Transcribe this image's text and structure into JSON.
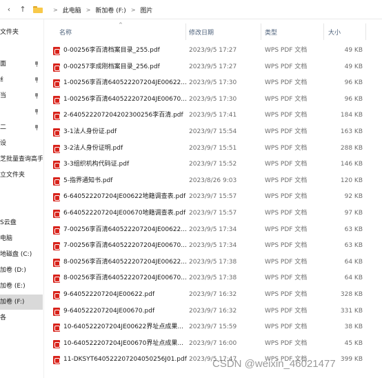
{
  "address_bar": {
    "back_glyph": "‹",
    "up_glyph": "↑",
    "breadcrumbs": [
      "此电脑",
      "新加卷 (F:)",
      "图片"
    ]
  },
  "nav_pane": {
    "items": [
      {
        "label": "文件夹",
        "pinned": false,
        "selected": false
      },
      {
        "label": "",
        "pinned": false,
        "selected": false
      },
      {
        "label": "面",
        "pinned": true,
        "selected": false
      },
      {
        "label": "纟",
        "pinned": true,
        "selected": false
      },
      {
        "label": "当",
        "pinned": true,
        "selected": false
      },
      {
        "label": "",
        "pinned": true,
        "selected": false
      },
      {
        "label": "二",
        "pinned": true,
        "selected": false
      },
      {
        "label": "设",
        "pinned": false,
        "selected": false
      },
      {
        "label": "芝批量查询高手",
        "pinned": false,
        "selected": false
      },
      {
        "label": "立文件夹",
        "pinned": false,
        "selected": false
      },
      {
        "label": "",
        "pinned": false,
        "selected": false
      },
      {
        "label": "",
        "pinned": false,
        "selected": false
      },
      {
        "label": "S云盘",
        "pinned": false,
        "selected": false
      },
      {
        "label": "电脑",
        "pinned": false,
        "selected": false
      },
      {
        "label": "地磁盘 (C:)",
        "pinned": false,
        "selected": false
      },
      {
        "label": "加卷 (D:)",
        "pinned": false,
        "selected": false
      },
      {
        "label": "加卷 (E:)",
        "pinned": false,
        "selected": false
      },
      {
        "label": "加卷 (F:)",
        "pinned": false,
        "selected": true
      },
      {
        "label": "各",
        "pinned": false,
        "selected": false
      }
    ]
  },
  "columns": {
    "name": "名称",
    "date": "修改日期",
    "type": "类型",
    "size": "大小",
    "sort_glyph": "^"
  },
  "files": [
    {
      "name": "0-00256李百清档案目录_255.pdf",
      "date": "2023/9/5 17:27",
      "type": "WPS PDF 文档",
      "size": "49 KB"
    },
    {
      "name": "0-00257李成刚档案目录_256.pdf",
      "date": "2023/9/5 17:27",
      "type": "WPS PDF 文档",
      "size": "49 KB"
    },
    {
      "name": "1-00256李百清640522207204JE00622...",
      "date": "2023/9/5 17:30",
      "type": "WPS PDF 文档",
      "size": "96 KB"
    },
    {
      "name": "1-00256李百清640522207204JE00670...",
      "date": "2023/9/5 17:30",
      "type": "WPS PDF 文档",
      "size": "96 KB"
    },
    {
      "name": "2-640522207204202300256李百清.pdf",
      "date": "2023/9/5 17:41",
      "type": "WPS PDF 文档",
      "size": "184 KB"
    },
    {
      "name": "3-1法人身份证.pdf",
      "date": "2023/9/7 15:54",
      "type": "WPS PDF 文档",
      "size": "163 KB"
    },
    {
      "name": "3-2法人身份证明.pdf",
      "date": "2023/9/7 15:51",
      "type": "WPS PDF 文档",
      "size": "288 KB"
    },
    {
      "name": "3-3组织机构代码证.pdf",
      "date": "2023/9/7 15:52",
      "type": "WPS PDF 文档",
      "size": "146 KB"
    },
    {
      "name": "5-指界通知书.pdf",
      "date": "2023/8/26 9:03",
      "type": "WPS PDF 文档",
      "size": "120 KB"
    },
    {
      "name": "6-640522207204JE00622地籍调查表.pdf",
      "date": "2023/9/7 15:57",
      "type": "WPS PDF 文档",
      "size": "92 KB"
    },
    {
      "name": "6-640522207204JE00670地籍调查表.pdf",
      "date": "2023/9/7 15:57",
      "type": "WPS PDF 文档",
      "size": "97 KB"
    },
    {
      "name": "7-00256李百清640522207204JE00622...",
      "date": "2023/9/5 17:34",
      "type": "WPS PDF 文档",
      "size": "63 KB"
    },
    {
      "name": "7-00256李百清640522207204JE00670...",
      "date": "2023/9/5 17:34",
      "type": "WPS PDF 文档",
      "size": "63 KB"
    },
    {
      "name": "8-00256李百清640522207204JE00622...",
      "date": "2023/9/5 17:38",
      "type": "WPS PDF 文档",
      "size": "64 KB"
    },
    {
      "name": "8-00256李百清640522207204JE00670...",
      "date": "2023/9/5 17:38",
      "type": "WPS PDF 文档",
      "size": "64 KB"
    },
    {
      "name": "9-640522207204JE00622.pdf",
      "date": "2023/9/7 16:32",
      "type": "WPS PDF 文档",
      "size": "328 KB"
    },
    {
      "name": "9-640522207204JE00670.pdf",
      "date": "2023/9/7 16:32",
      "type": "WPS PDF 文档",
      "size": "331 KB"
    },
    {
      "name": "10-640522207204JE00622界址点成果...",
      "date": "2023/9/7 15:59",
      "type": "WPS PDF 文档",
      "size": "38 KB"
    },
    {
      "name": "10-640522207204JE00670界址点成果...",
      "date": "2023/9/7 16:00",
      "type": "WPS PDF 文档",
      "size": "45 KB"
    },
    {
      "name": "11-DKSYT640522207204050256J01.pdf",
      "date": "2023/9/5 17:47",
      "type": "WPS PDF 文档",
      "size": "399 KB"
    }
  ],
  "watermark": "CSDN @weixin_46021477"
}
